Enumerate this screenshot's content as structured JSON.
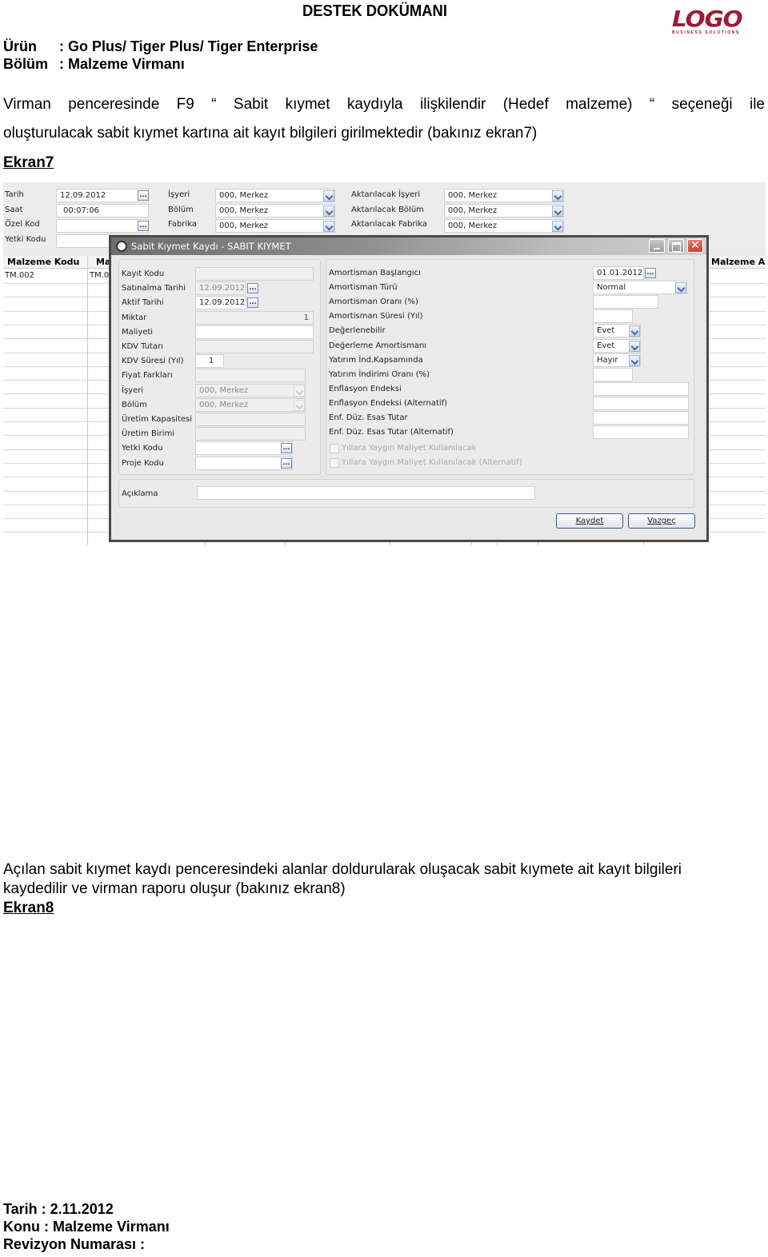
{
  "header": {
    "title": "DESTEK DOKÜMANI",
    "logo_text": "LOGO",
    "logo_subtext": "BUSINESS SOLUTIONS",
    "brand_color": "#9c1b37",
    "product_label": "Ürün",
    "product_value": ": Go Plus/ Tiger Plus/ Tiger Enterprise",
    "section_label": "Bölüm",
    "section_value": ": Malzeme Virmanı"
  },
  "body": {
    "para1_line1": "Virman penceresinde F9 “ Sabit kıymet kaydıyla ilişkilendir (Hedef malzeme) “ seçeneği ile",
    "para1_line2": "oluşturulacak sabit kıymet kartına ait kayıt bilgileri girilmektedir (bakınız ekran7)",
    "ekran7": "Ekran7",
    "para2_line1": "Açılan sabit kıymet kaydı penceresindeki alanlar doldurularak oluşacak sabit kıymete ait kayıt bilgileri",
    "para2_line2": "kaydedilir ve virman raporu oluşur (bakınız ekran8)",
    "ekran8": "Ekran8"
  },
  "screenshot": {
    "top_form": {
      "tarih_label": "Tarih",
      "tarih_value": "12.09.2012",
      "saat_label": "Saat",
      "saat_value": "00:07:06",
      "ozel_kod_label": "Özel Kod",
      "ozel_kod_value": "",
      "yetki_kodu_label": "Yetki Kodu",
      "yetki_kodu_value": "",
      "isyeri_label": "İşyeri",
      "isyeri_value": "000, Merkez",
      "bolum_label": "Bölüm",
      "bolum_value": "000, Merkez",
      "fabrika_label": "Fabrika",
      "fabrika_value": "000, Merkez",
      "akt_isyeri_label": "Aktarılacak İşyeri",
      "akt_isyeri_value": "000, Merkez",
      "akt_bolum_label": "Aktarılacak Bölüm",
      "akt_bolum_value": "000, Merkez",
      "akt_fabrika_label": "Aktarılacak Fabrika",
      "akt_fabrika_value": "000, Merkez",
      "dots": "..."
    },
    "grid": {
      "columns": [
        "Malzeme Kodu",
        "Ma",
        "Malzeme A"
      ],
      "rows": [
        [
          "TM.002",
          "TM.0"
        ]
      ]
    },
    "dialog": {
      "title": "Sabit Kıymet Kaydı - SABIT KIYMET",
      "close_glyph": "✕",
      "left": {
        "kayit_kodu_label": "Kayıt Kodu",
        "kayit_kodu_value": "",
        "satinalma_tarihi_label": "Satınalma Tarihi",
        "satinalma_tarihi_value": "12.09.2012",
        "aktif_tarihi_label": "Aktif Tarihi",
        "aktif_tarihi_value": "12.09.2012",
        "miktar_label": "Miktar",
        "miktar_value": "1",
        "maliyeti_label": "Maliyeti",
        "maliyeti_value": "",
        "kdv_tutari_label": "KDV Tutarı",
        "kdv_tutari_value": "",
        "kdv_suresi_label": "KDV Süresi (Yıl)",
        "kdv_suresi_value": "1",
        "fiyat_farklari_label": "Fiyat Farkları",
        "fiyat_farklari_value": "",
        "isyeri_label": "İşyeri",
        "isyeri_value": "000, Merkez",
        "bolum_label": "Bölüm",
        "bolum_value": "000, Merkez",
        "uretim_kapasitesi_label": "Üretim Kapasitesi",
        "uretim_kapasitesi_value": "",
        "uretim_birimi_label": "Üretim Birimi",
        "uretim_birimi_value": "",
        "yetki_kodu_label": "Yetki Kodu",
        "yetki_kodu_value": "",
        "proje_kodu_label": "Proje Kodu",
        "proje_kodu_value": ""
      },
      "right": {
        "amort_baslangic_label": "Amortisman Başlangıcı",
        "amort_baslangic_value": "01.01.2012",
        "amort_turu_label": "Amortisman Türü",
        "amort_turu_value": "Normal",
        "amort_orani_label": "Amortisman Oranı (%)",
        "amort_orani_value": "",
        "amort_suresi_label": "Amortisman Süresi (Yıl)",
        "amort_suresi_value": "",
        "degerlenebilir_label": "Değerlenebilir",
        "degerlenebilir_value": "Evet",
        "degerleme_amort_label": "Değerleme Amortismanı",
        "degerleme_amort_value": "Evet",
        "yatirim_ind_kaps_label": "Yatırım İnd.Kapsamında",
        "yatirim_ind_kaps_value": "Hayır",
        "yatirim_ind_orani_label": "Yatırım İndirimi Oranı (%)",
        "yatirim_ind_orani_value": "",
        "enf_endeksi_label": "Enflasyon Endeksi",
        "enf_endeksi_value": "",
        "enf_endeksi_alt_label": "Enflasyon Endeksi  (Alternatif)",
        "enf_endeksi_alt_value": "",
        "enf_duz_esas_label": "Enf. Düz. Esas Tutar",
        "enf_duz_esas_value": "",
        "enf_duz_esas_alt_label": "Enf. Düz. Esas Tutar (Alternatif)",
        "enf_duz_esas_alt_value": "",
        "yillara_yaygin_label": "Yıllara Yaygın Maliyet Kullanılacak",
        "yillara_yaygin_alt_label": "Yıllara Yaygın Maliyet Kullanılacak (Alternatif)"
      },
      "aciklama_label": "Açıklama",
      "aciklama_value": "",
      "save_label": "Kaydet",
      "cancel_label": "Vazgeç"
    }
  },
  "footer": {
    "date_line": "Tarih : 2.11.2012",
    "subject_line": "Konu : Malzeme Virmanı",
    "revision_line": "Revizyon Numarası :"
  }
}
